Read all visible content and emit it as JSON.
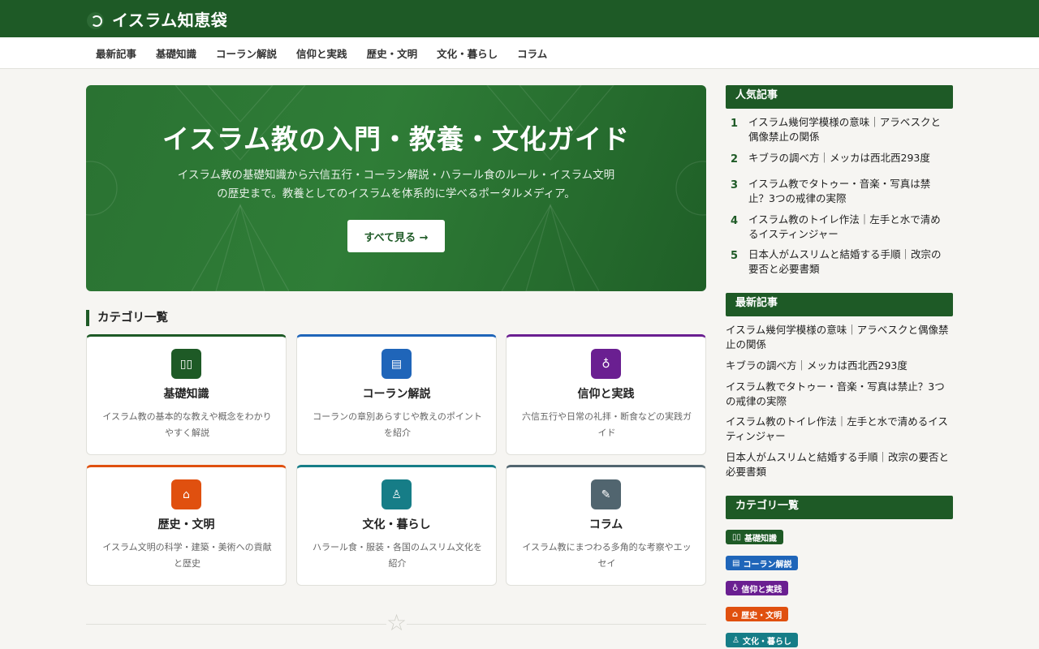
{
  "site": {
    "logo_text": "イスラム知恵袋",
    "logo_icon": "crescent-icon"
  },
  "nav": {
    "items": [
      "最新記事",
      "基礎知識",
      "コーラン解説",
      "信仰と実践",
      "歴史・文明",
      "文化・暮らし",
      "コラム"
    ]
  },
  "hero": {
    "title": "イスラム教の入門・教養・文化ガイド",
    "description_line1": "イスラム教の基礎知識から六信五行・コーラン解説・ハラール食のルール・イスラム文明",
    "description_line2": "の歴史まで。教養としてのイスラムを体系的に学べるポータルメディア。",
    "button_label": "すべて見る →"
  },
  "categories": {
    "title": "カテゴリ一覧",
    "items": [
      {
        "name": "基礎知識",
        "desc": "イスラム教の基本的な教えや概念をわかりやすく解説",
        "color": "#1e5a26",
        "icon": "book-icon",
        "glyph": "▯▯"
      },
      {
        "name": "コーラン解説",
        "desc": "コーランの章別あらすじや教えのポイントを紹介",
        "color": "#1f65b9",
        "icon": "scripture-icon",
        "glyph": "▤"
      },
      {
        "name": "信仰と実践",
        "desc": "六信五行や日常の礼拝・断食などの実践ガイド",
        "color": "#6a1f91",
        "icon": "prayer-icon",
        "glyph": "♁"
      },
      {
        "name": "歴史・文明",
        "desc": "イスラム文明の科学・建築・美術への貢献と歴史",
        "color": "#e0500f",
        "icon": "mosque-icon",
        "glyph": "⌂"
      },
      {
        "name": "文化・暮らし",
        "desc": "ハラール食・服装・各国のムスリム文化を紹介",
        "color": "#167d87",
        "icon": "lantern-icon",
        "glyph": "♙"
      },
      {
        "name": "コラム",
        "desc": "イスラム教にまつわる多角的な考察やエッセイ",
        "color": "#51656f",
        "icon": "pen-icon",
        "glyph": "✎"
      }
    ]
  },
  "sidebar": {
    "popular": {
      "title": "人気記事",
      "items": [
        {
          "rank": "1",
          "title": "イスラム幾何学模様の意味｜アラベスクと偶像禁止の関係"
        },
        {
          "rank": "2",
          "title": "キブラの調べ方｜メッカは西北西293度"
        },
        {
          "rank": "3",
          "title": "イスラム教でタトゥー・音楽・写真は禁止？3つの戒律の実際"
        },
        {
          "rank": "4",
          "title": "イスラム教のトイレ作法｜左手と水で清めるイスティンジャー"
        },
        {
          "rank": "5",
          "title": "日本人がムスリムと結婚する手順｜改宗の要否と必要書類"
        }
      ]
    },
    "latest": {
      "title": "最新記事",
      "items": [
        "イスラム幾何学模様の意味｜アラベスクと偶像禁止の関係",
        "キブラの調べ方｜メッカは西北西293度",
        "イスラム教でタトゥー・音楽・写真は禁止？3つの戒律の実際",
        "イスラム教のトイレ作法｜左手と水で清めるイスティンジャー",
        "日本人がムスリムと結婚する手順｜改宗の要否と必要書類"
      ]
    },
    "categories": {
      "title": "カテゴリ一覧",
      "tags": [
        {
          "label": "基礎知識",
          "color": "#1e5a26",
          "glyph": "▯▯"
        },
        {
          "label": "コーラン解説",
          "color": "#1f65b9",
          "glyph": "▤"
        },
        {
          "label": "信仰と実践",
          "color": "#6a1f91",
          "glyph": "♁"
        },
        {
          "label": "歴史・文明",
          "color": "#e0500f",
          "glyph": "⌂"
        },
        {
          "label": "文化・暮らし",
          "color": "#167d87",
          "glyph": "♙"
        }
      ]
    }
  },
  "footer": {
    "ornament_icon": "star-icon"
  }
}
